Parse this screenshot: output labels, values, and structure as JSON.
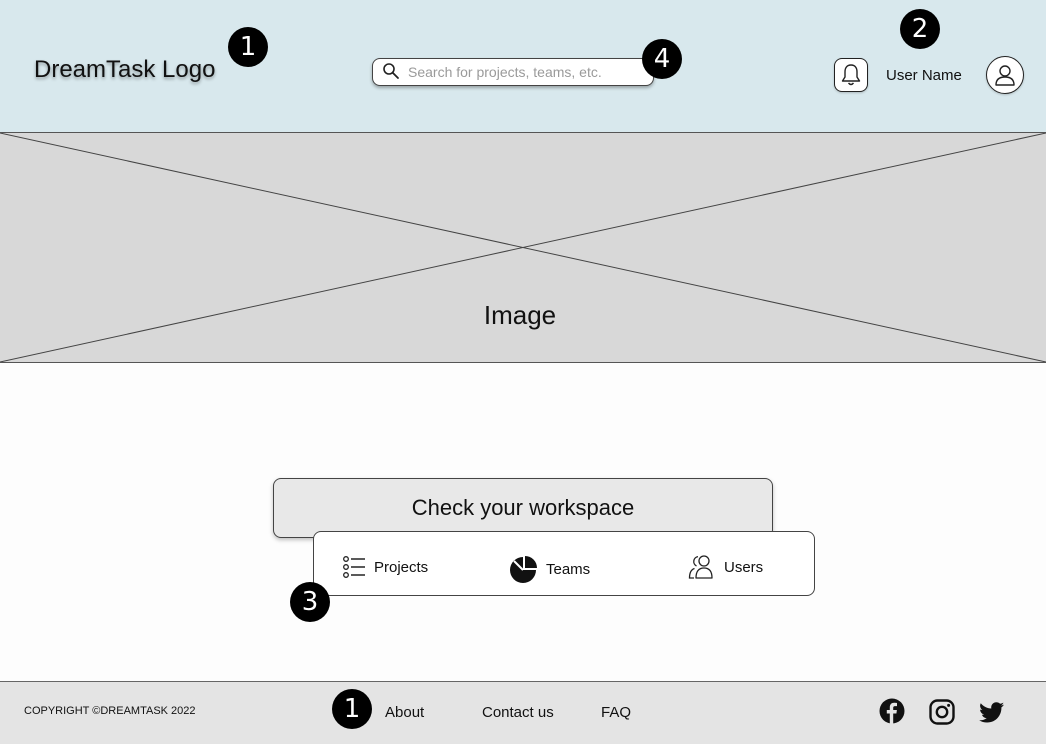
{
  "header": {
    "logo_text": "DreamTask Logo",
    "search_placeholder": "Search for projects, teams, etc.",
    "user_name": "User Name"
  },
  "badges": {
    "logo_badge": "1",
    "user_badge": "2",
    "menu_badge": "3",
    "search_badge": "4",
    "footer_badge": "1"
  },
  "hero": {
    "label": "Image"
  },
  "workspace": {
    "button_label": "Check your workspace",
    "items": [
      {
        "label": "Projects",
        "icon": "list-icon"
      },
      {
        "label": "Teams",
        "icon": "pie-chart-icon"
      },
      {
        "label": "Users",
        "icon": "users-icon"
      }
    ]
  },
  "footer": {
    "copyright": "COPYRIGHT ©DREAMTASK 2022",
    "links": [
      {
        "label": "About"
      },
      {
        "label": "Contact us"
      },
      {
        "label": "FAQ"
      }
    ],
    "social_icons": [
      "facebook-icon",
      "instagram-icon",
      "twitter-icon"
    ]
  },
  "colors": {
    "header_bg": "#d8e8ed",
    "placeholder_bg": "#d8d8d8",
    "footer_bg": "#e4e4e4",
    "badge_bg": "#000000"
  }
}
